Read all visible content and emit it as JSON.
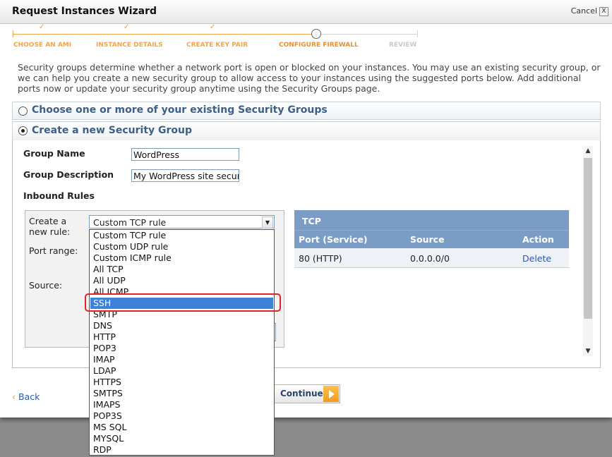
{
  "window": {
    "title": "Request Instances Wizard",
    "cancel_label": "Cancel",
    "close_glyph": "X"
  },
  "steps": [
    {
      "label": "CHOOSE AN AMI",
      "status": "done",
      "tick": "✓"
    },
    {
      "label": "INSTANCE DETAILS",
      "status": "done",
      "tick": "✓"
    },
    {
      "label": "CREATE KEY PAIR",
      "status": "done",
      "tick": "✓"
    },
    {
      "label": "CONFIGURE FIREWALL",
      "status": "current"
    },
    {
      "label": "REVIEW",
      "status": "pending"
    }
  ],
  "intro_text": "Security groups determine whether a network port is open or blocked on your instances. You may use an existing security group, or we can help you create a new security group to allow access to your instances using the suggested ports below. Add additional ports now or update your security group anytime using the Security Groups page.",
  "options": {
    "existing": {
      "label": "Choose one or more of your existing Security Groups",
      "selected": false
    },
    "create_new": {
      "label": "Create a new Security Group",
      "selected": true
    }
  },
  "form": {
    "group_name_label": "Group Name",
    "group_name_value": "WordPress",
    "group_description_label": "Group Description",
    "group_description_value": "My WordPress site secur",
    "inbound_rules_label": "Inbound Rules"
  },
  "rule_editor": {
    "create_rule_label": "Create a new rule:",
    "port_range_label": "Port range:",
    "source_label": "Source:",
    "selected_rule": "Custom TCP rule",
    "rule_options": [
      "Custom TCP rule",
      "Custom UDP rule",
      "Custom ICMP rule",
      "All TCP",
      "All UDP",
      "All ICMP",
      "SSH",
      "SMTP",
      "DNS",
      "HTTP",
      "POP3",
      "IMAP",
      "LDAP",
      "HTTPS",
      "SMTPS",
      "IMAPS",
      "POP3S",
      "MS SQL",
      "MYSQL",
      "RDP"
    ],
    "highlighted_option": "SSH"
  },
  "rules_table": {
    "protocol": "TCP",
    "columns": [
      "Port (Service)",
      "Source",
      "Action"
    ],
    "rows": [
      {
        "port": "80 (HTTP)",
        "source": "0.0.0.0/0",
        "action": "Delete"
      }
    ]
  },
  "footer": {
    "back_label": "Back",
    "back_glyph": "‹",
    "continue_label": "Continue"
  },
  "colors": {
    "step_done": "#f0a64a",
    "link": "#2a5aa8",
    "highlight_border": "#e0242a",
    "table_header": "#7b9dc5",
    "selected_option": "#3f80d9"
  }
}
